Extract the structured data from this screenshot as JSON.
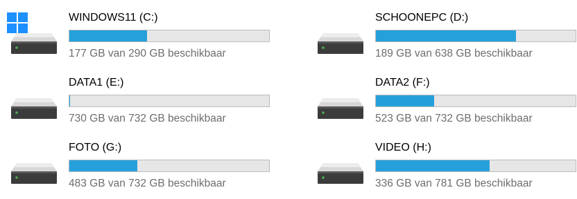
{
  "drives": [
    {
      "label": "WINDOWS11 (C:)",
      "free_text": "177 GB van 290 GB beschikbaar",
      "used_fraction": 0.39,
      "icon": "windows-logo-hdd-icon"
    },
    {
      "label": "SCHOONEPC (D:)",
      "free_text": "189 GB van 638 GB beschikbaar",
      "used_fraction": 0.7,
      "icon": "hdd-icon"
    },
    {
      "label": "DATA1 (E:)",
      "free_text": "730 GB van 732 GB beschikbaar",
      "used_fraction": 0.003,
      "icon": "hdd-icon"
    },
    {
      "label": "DATA2 (F:)",
      "free_text": "523 GB van 732 GB beschikbaar",
      "used_fraction": 0.29,
      "icon": "hdd-icon"
    },
    {
      "label": "FOTO (G:)",
      "free_text": "483 GB van 732 GB beschikbaar",
      "used_fraction": 0.34,
      "icon": "hdd-icon"
    },
    {
      "label": "VIDEO (H:)",
      "free_text": "336 GB van 781 GB beschikbaar",
      "used_fraction": 0.57,
      "icon": "hdd-icon"
    }
  ],
  "colors": {
    "bar_fill": "#26a0da",
    "bar_track": "#e6e6e6",
    "windows_logo": "#1e90ff"
  }
}
